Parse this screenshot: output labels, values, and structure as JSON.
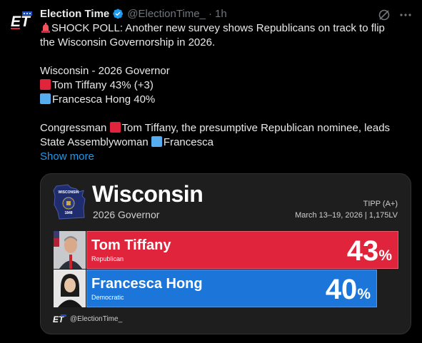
{
  "tweet": {
    "author_name": "Election Time",
    "handle": "@ElectionTime_",
    "separator": "·",
    "time": "1h",
    "avatar_text": "ET",
    "lines": [
      "SHOCK POLL: Another new survey shows Republicans on track to flip",
      "the Wisconsin Governorship in 2026.",
      "Wisconsin - 2026 Governor",
      "Tom Tiffany 43% (+3)",
      "Francesca Hong 40%",
      "Congressman ",
      "Tom Tiffany, the presumptive Republican nominee, leads",
      "State Assemblywoman ",
      "Francesca"
    ],
    "show_more": "Show more"
  },
  "graphic": {
    "title": "Wisconsin",
    "subtitle": "2026 Governor",
    "pollster": "TIPP (A+)",
    "dates_sample": "March 13–19, 2026 | 1,175LV",
    "seal_top": "WISCONSIN",
    "seal_year": "1848",
    "footer_logo": "ET",
    "footer_handle": "@ElectionTime_",
    "candidates": [
      {
        "name": "Tom Tiffany",
        "party": "Republican",
        "pct_value": 43,
        "pct_num": "43",
        "pct_sign": "%",
        "color": "#e0243c"
      },
      {
        "name": "Francesca Hong",
        "party": "Democratic",
        "pct_value": 40,
        "pct_num": "40",
        "pct_sign": "%",
        "color": "#1c75d8"
      }
    ]
  },
  "colors": {
    "accent_blue": "#1d9bf0",
    "text": "#e7e9ea",
    "muted": "#71767b"
  }
}
